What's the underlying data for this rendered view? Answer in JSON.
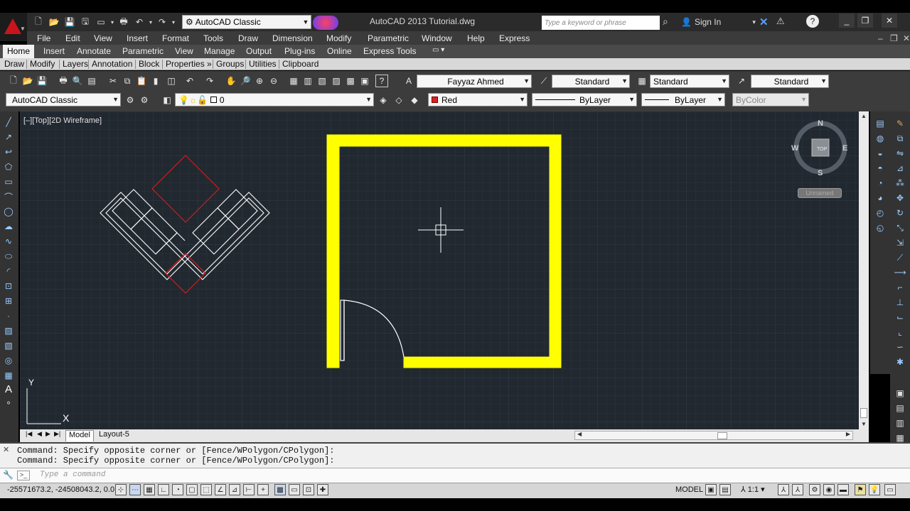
{
  "app": {
    "workspace": "AutoCAD Classic",
    "title": "AutoCAD 2013    Tutorial.dwg",
    "search_placeholder": "Type a keyword or phrase",
    "sign_in": "Sign In"
  },
  "menubar": [
    "File",
    "Edit",
    "View",
    "Insert",
    "Format",
    "Tools",
    "Draw",
    "Dimension",
    "Modify",
    "Parametric",
    "Window",
    "Help",
    "Express"
  ],
  "ribbon_tabs": [
    "Home",
    "Insert",
    "Annotate",
    "Parametric",
    "View",
    "Manage",
    "Output",
    "Plug-ins",
    "Online",
    "Express Tools"
  ],
  "panels": [
    "Draw",
    "Modify",
    "Layers",
    "Annotation",
    "Block",
    "Properties »",
    "Groups",
    "Utilities",
    "Clipboard"
  ],
  "styles": {
    "user_text_style": "Fayyaz Ahmed",
    "dim_style": "Standard",
    "table_style": "Standard",
    "mleader_style": "Standard"
  },
  "layers_row": {
    "workspace": "AutoCAD Classic",
    "layer": "0",
    "color": "Red",
    "color_hex": "#e02020",
    "linetype": "ByLayer",
    "lineweight": "ByLayer",
    "plotstyle": "ByColor"
  },
  "viewport": {
    "label": "[–][Top][2D Wireframe]",
    "ucs_y": "Y",
    "ucs_x": "X"
  },
  "viewcube": {
    "n": "N",
    "s": "S",
    "e": "E",
    "w": "W",
    "face": "TOP",
    "ucs_menu": "Unnamed"
  },
  "layout_tabs": [
    "Model",
    "Layout-5"
  ],
  "command": {
    "history": [
      "Command: Specify opposite corner or [Fence/WPolygon/CPolygon]:",
      "Command: Specify opposite corner or [Fence/WPolygon/CPolygon]:"
    ],
    "placeholder": "Type a command"
  },
  "status": {
    "coords": "-25571673.2, -24508043.2, 0.0",
    "space": "MODEL",
    "anno_scale": "1:1"
  },
  "colors": {
    "canvas_bg": "#212830",
    "wall": "#ffff00",
    "furniture": "#ffffff",
    "accent_red": "#c82020"
  },
  "icons": [
    "new-icon",
    "open-icon",
    "save-icon",
    "saveas-icon",
    "plot-icon",
    "undo-icon",
    "redo-icon",
    "search-icon",
    "infocenter-icon",
    "signin-icon",
    "exchange-icon",
    "help-icon",
    "minimize-icon",
    "restore-icon",
    "close-icon"
  ]
}
